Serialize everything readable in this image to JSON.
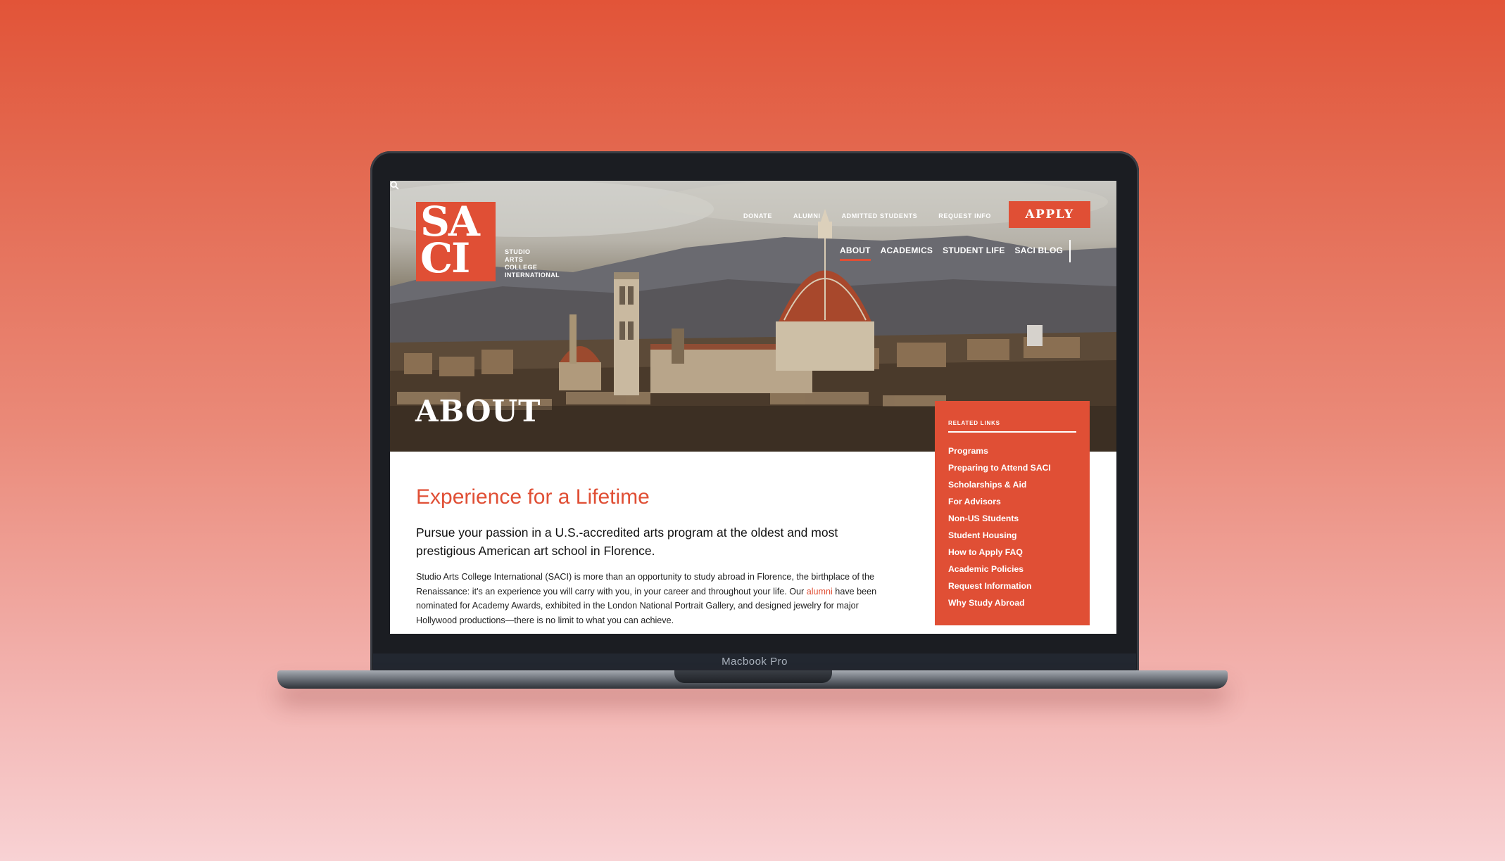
{
  "device": {
    "label": "Macbook Pro"
  },
  "logo": {
    "line1": "SA",
    "line2": "CI",
    "wordmark": [
      "STUDIO",
      "ARTS",
      "COLLEGE",
      "INTERNATIONAL"
    ]
  },
  "top_nav": [
    "DONATE",
    "ALUMNI",
    "ADMITTED STUDENTS",
    "REQUEST INFO"
  ],
  "apply_label": "APPLY",
  "main_nav": [
    "ABOUT",
    "ACADEMICS",
    "STUDENT LIFE",
    "SACI BLOG"
  ],
  "active_nav": "ABOUT",
  "hero_title": "ABOUT",
  "content": {
    "title": "Experience for a Lifetime",
    "lead": "Pursue your passion in a U.S.-accredited arts program at the oldest and most prestigious American art school in Florence.",
    "body_before_link": "Studio Arts College International (SACI) is more than an opportunity to study abroad in Florence, the birthplace of the Renaissance: it's an experience you will carry with you, in your career and throughout your life. Our ",
    "body_link": "alumni",
    "body_after_link": " have been nominated for Academy Awards, exhibited in the London National Portrait Gallery, and designed jewelry for major Hollywood productions—there is no limit to what you can achieve."
  },
  "related_links": {
    "heading": "RELATED LINKS",
    "items": [
      "Programs",
      "Preparing to Attend SACI",
      "Scholarships & Aid",
      "For Advisors",
      "Non-US Students",
      "Student Housing",
      "How to Apply FAQ",
      "Academic Policies",
      "Request Information",
      "Why Study Abroad"
    ]
  },
  "colors": {
    "accent": "#e04f35",
    "background_top": "#e25438",
    "background_bottom": "#f8d2d4"
  },
  "icons": [
    "search-icon"
  ]
}
